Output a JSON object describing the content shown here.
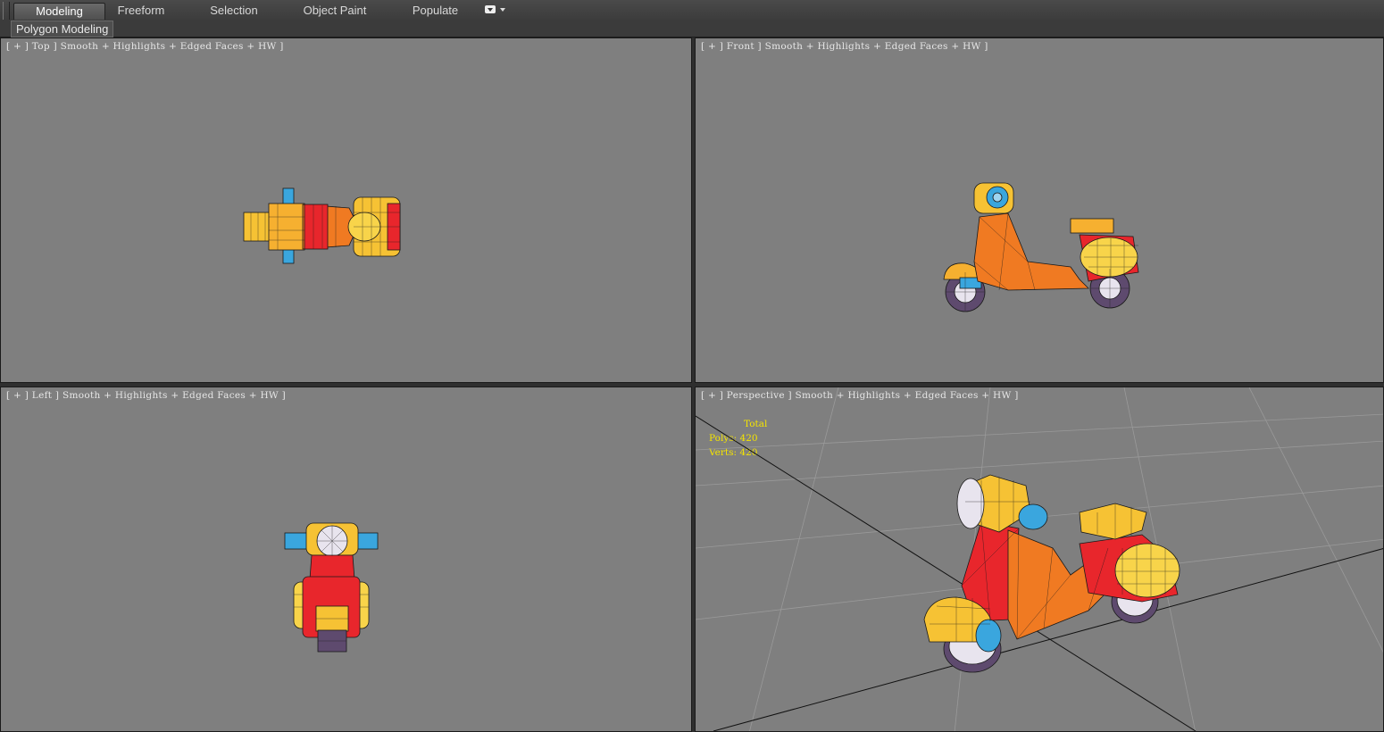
{
  "ribbon": {
    "tabs": [
      "Modeling",
      "Freeform",
      "Selection",
      "Object Paint",
      "Populate"
    ],
    "active_tab": "Modeling",
    "panel_label": "Polygon Modeling"
  },
  "viewports": {
    "top": {
      "label": "[ + ] Top ] Smooth + Highlights + Edged Faces + HW ]"
    },
    "front": {
      "label": "[ + ] Front ] Smooth + Highlights + Edged Faces + HW ]"
    },
    "left": {
      "label": "[ + ] Left ] Smooth + Highlights + Edged Faces + HW ]"
    },
    "perspective": {
      "label": "[ + ] Perspective ] Smooth + Highlights + Edged Faces + HW ]",
      "stats": {
        "title": "Total",
        "polys": "Polys: 420",
        "verts": "Verts: 420"
      }
    }
  },
  "colors": {
    "viewport_bg": "#7f7f7f",
    "stats_text": "#f4e400",
    "body_red": "#e8262c",
    "body_orange": "#f07a22",
    "seat_yellow": "#f6c234",
    "handle_blue": "#3aa6de",
    "tire_purple": "#5e4a6e"
  }
}
